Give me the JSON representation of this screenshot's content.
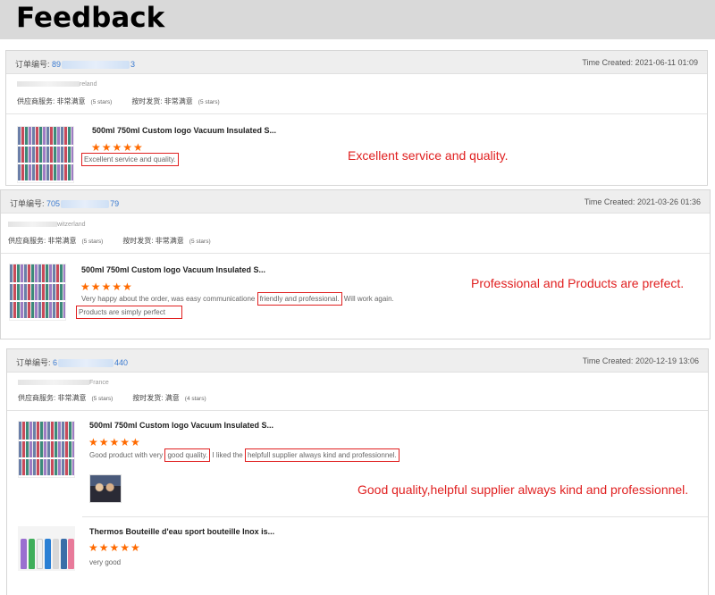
{
  "header": {
    "title": "Feedback"
  },
  "labels": {
    "order_no": "订单编号:",
    "time_created": "Time Created:",
    "supplier_service": "供应商服务:",
    "on_time_shipping": "按时发货:",
    "very_satisfied": "非常满意",
    "satisfied": "满意",
    "five_stars": "(5 stars)",
    "four_stars": "(4 stars)",
    "stars": "★★★★★"
  },
  "cards": [
    {
      "order_prefix": "89",
      "order_suffix": "3",
      "time": "2021-06-11 01:09",
      "buyer_country": "reland",
      "shipping_rating": "非常满意",
      "shipping_stars": "(5 stars)",
      "items": [
        {
          "title": "500ml 750ml Custom logo Vacuum Insulated S...",
          "review_parts": [
            "Excellent service and quality."
          ]
        }
      ],
      "annotation": "Excellent service and quality."
    },
    {
      "order_prefix": "705",
      "order_suffix": "79",
      "time": "2021-03-26 01:36",
      "buyer_country": "witzerland",
      "shipping_rating": "非常满意",
      "shipping_stars": "(5 stars)",
      "items": [
        {
          "title": "500ml 750ml Custom logo Vacuum Insulated S...",
          "review_parts": [
            "Very happy about the order, was easy communicatione ",
            "friendly and professional.",
            " Will work again.",
            "Products are simply perfect"
          ]
        }
      ],
      "annotation": "Professional and Products are prefect."
    },
    {
      "order_prefix": "6",
      "order_suffix": "440",
      "time": "2020-12-19 13:06",
      "buyer_country": "France",
      "shipping_rating": "满意",
      "shipping_stars": "(4 stars)",
      "items": [
        {
          "title": "500ml 750ml Custom logo Vacuum Insulated S...",
          "review_parts": [
            "Good product with very ",
            "good quality.",
            " I liked the ",
            "helpfull supplier always kind and professionnel."
          ]
        },
        {
          "title": "Thermos Bouteille d'eau sport bouteille Inox is...",
          "review_parts": [
            "very good"
          ]
        }
      ],
      "annotation": "Good quality,helpful supplier always kind and professionnel."
    }
  ],
  "colors": {
    "accent_red": "#e02020",
    "star_orange": "#ff6a00",
    "order_link": "#3b7bd1"
  }
}
